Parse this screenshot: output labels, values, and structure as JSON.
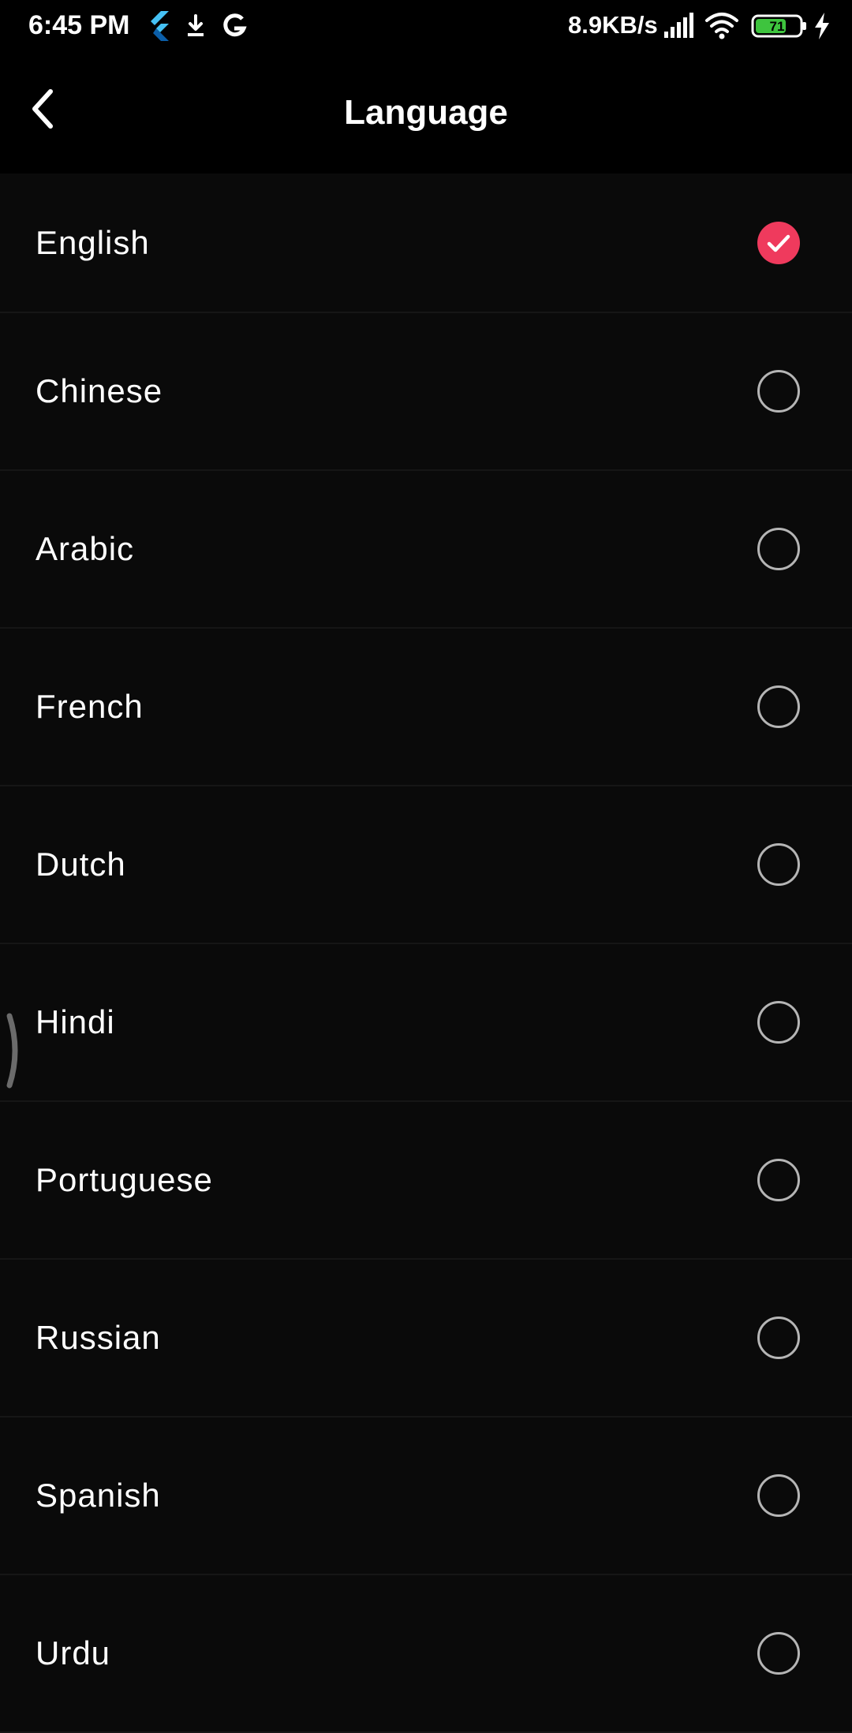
{
  "status_bar": {
    "time": "6:45 PM",
    "net_speed": "8.9KB/s",
    "battery_level": "71",
    "icons": [
      "flutter-icon",
      "download-icon",
      "google-icon",
      "signal-icon",
      "wifi-icon",
      "battery-icon",
      "charging-icon"
    ]
  },
  "app_bar": {
    "title": "Language",
    "back_icon": "back-arrow-icon"
  },
  "languages": [
    {
      "label": "English",
      "selected": true
    },
    {
      "label": "Chinese",
      "selected": false
    },
    {
      "label": "Arabic",
      "selected": false
    },
    {
      "label": "French",
      "selected": false
    },
    {
      "label": "Dutch",
      "selected": false
    },
    {
      "label": "Hindi",
      "selected": false
    },
    {
      "label": "Portuguese",
      "selected": false
    },
    {
      "label": "Russian",
      "selected": false
    },
    {
      "label": "Spanish",
      "selected": false
    },
    {
      "label": "Urdu",
      "selected": false
    }
  ],
  "colors": {
    "background": "#000000",
    "list_background": "#0a0a0a",
    "accent": "#ef3a5d",
    "radio_border": "#b5b5b5",
    "battery_fill": "#3ec43e"
  }
}
